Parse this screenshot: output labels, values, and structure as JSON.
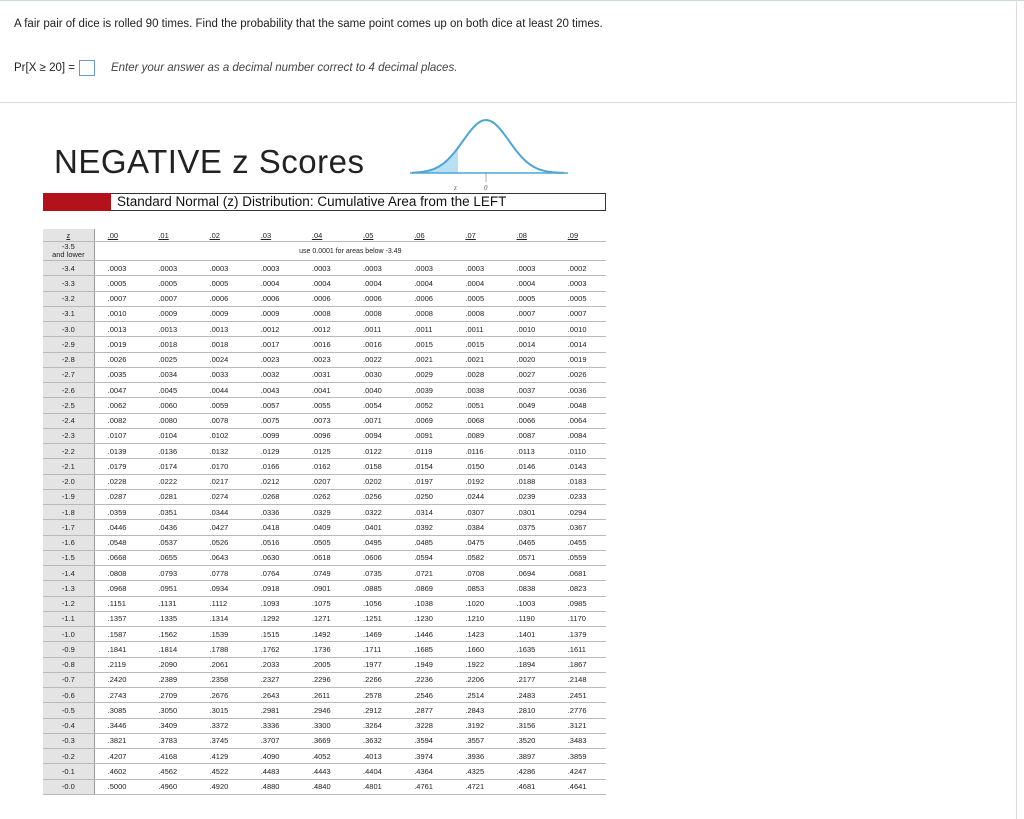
{
  "question": "A fair pair of dice is rolled 90 times. Find the probability that the same point comes up on both dice at least 20 times.",
  "answer": {
    "label": "Pr[X ≥ 20] =",
    "value": "",
    "hint": "Enter your answer as a decimal number correct to 4 decimal places."
  },
  "ztable": {
    "title": "NEGATIVE z Scores",
    "subtitle": "Standard Normal (z) Distribution:  Cumulative Area from the LEFT",
    "curve_labels": {
      "z": "z",
      "zero": "0"
    },
    "colors": {
      "accent": "#b3121a",
      "curve": "#4ba6d6",
      "shade": "#b9dff2"
    },
    "headers": [
      "z",
      ".00",
      ".01",
      ".02",
      ".03",
      ".04",
      ".05",
      ".06",
      ".07",
      ".08",
      ".09"
    ],
    "special_row": {
      "z": "-3.5\nand lower",
      "note": "use 0.0001 for areas below -3.49"
    },
    "rows": [
      [
        "-3.4",
        ".0003",
        ".0003",
        ".0003",
        ".0003",
        ".0003",
        ".0003",
        ".0003",
        ".0003",
        ".0003",
        ".0002"
      ],
      [
        "-3.3",
        ".0005",
        ".0005",
        ".0005",
        ".0004",
        ".0004",
        ".0004",
        ".0004",
        ".0004",
        ".0004",
        ".0003"
      ],
      [
        "-3.2",
        ".0007",
        ".0007",
        ".0006",
        ".0006",
        ".0006",
        ".0006",
        ".0006",
        ".0005",
        ".0005",
        ".0005"
      ],
      [
        "-3.1",
        ".0010",
        ".0009",
        ".0009",
        ".0009",
        ".0008",
        ".0008",
        ".0008",
        ".0008",
        ".0007",
        ".0007"
      ],
      [
        "-3.0",
        ".0013",
        ".0013",
        ".0013",
        ".0012",
        ".0012",
        ".0011",
        ".0011",
        ".0011",
        ".0010",
        ".0010"
      ],
      [
        "-2.9",
        ".0019",
        ".0018",
        ".0018",
        ".0017",
        ".0016",
        ".0016",
        ".0015",
        ".0015",
        ".0014",
        ".0014"
      ],
      [
        "-2.8",
        ".0026",
        ".0025",
        ".0024",
        ".0023",
        ".0023",
        ".0022",
        ".0021",
        ".0021",
        ".0020",
        ".0019"
      ],
      [
        "-2.7",
        ".0035",
        ".0034",
        ".0033",
        ".0032",
        ".0031",
        ".0030",
        ".0029",
        ".0028",
        ".0027",
        ".0026"
      ],
      [
        "-2.6",
        ".0047",
        ".0045",
        ".0044",
        ".0043",
        ".0041",
        ".0040",
        ".0039",
        ".0038",
        ".0037",
        ".0036"
      ],
      [
        "-2.5",
        ".0062",
        ".0060",
        ".0059",
        ".0057",
        ".0055",
        ".0054",
        ".0052",
        ".0051",
        ".0049",
        ".0048"
      ],
      [
        "-2.4",
        ".0082",
        ".0080",
        ".0078",
        ".0075",
        ".0073",
        ".0071",
        ".0069",
        ".0068",
        ".0066",
        ".0064"
      ],
      [
        "-2.3",
        ".0107",
        ".0104",
        ".0102",
        ".0099",
        ".0096",
        ".0094",
        ".0091",
        ".0089",
        ".0087",
        ".0084"
      ],
      [
        "-2.2",
        ".0139",
        ".0136",
        ".0132",
        ".0129",
        ".0125",
        ".0122",
        ".0119",
        ".0116",
        ".0113",
        ".0110"
      ],
      [
        "-2.1",
        ".0179",
        ".0174",
        ".0170",
        ".0166",
        ".0162",
        ".0158",
        ".0154",
        ".0150",
        ".0146",
        ".0143"
      ],
      [
        "-2.0",
        ".0228",
        ".0222",
        ".0217",
        ".0212",
        ".0207",
        ".0202",
        ".0197",
        ".0192",
        ".0188",
        ".0183"
      ],
      [
        "-1.9",
        ".0287",
        ".0281",
        ".0274",
        ".0268",
        ".0262",
        ".0256",
        ".0250",
        ".0244",
        ".0239",
        ".0233"
      ],
      [
        "-1.8",
        ".0359",
        ".0351",
        ".0344",
        ".0336",
        ".0329",
        ".0322",
        ".0314",
        ".0307",
        ".0301",
        ".0294"
      ],
      [
        "-1.7",
        ".0446",
        ".0436",
        ".0427",
        ".0418",
        ".0409",
        ".0401",
        ".0392",
        ".0384",
        ".0375",
        ".0367"
      ],
      [
        "-1.6",
        ".0548",
        ".0537",
        ".0526",
        ".0516",
        ".0505",
        ".0495",
        ".0485",
        ".0475",
        ".0465",
        ".0455"
      ],
      [
        "-1.5",
        ".0668",
        ".0655",
        ".0643",
        ".0630",
        ".0618",
        ".0606",
        ".0594",
        ".0582",
        ".0571",
        ".0559"
      ],
      [
        "-1.4",
        ".0808",
        ".0793",
        ".0778",
        ".0764",
        ".0749",
        ".0735",
        ".0721",
        ".0708",
        ".0694",
        ".0681"
      ],
      [
        "-1.3",
        ".0968",
        ".0951",
        ".0934",
        ".0918",
        ".0901",
        ".0885",
        ".0869",
        ".0853",
        ".0838",
        ".0823"
      ],
      [
        "-1.2",
        ".1151",
        ".1131",
        ".1112",
        ".1093",
        ".1075",
        ".1056",
        ".1038",
        ".1020",
        ".1003",
        ".0985"
      ],
      [
        "-1.1",
        ".1357",
        ".1335",
        ".1314",
        ".1292",
        ".1271",
        ".1251",
        ".1230",
        ".1210",
        ".1190",
        ".1170"
      ],
      [
        "-1.0",
        ".1587",
        ".1562",
        ".1539",
        ".1515",
        ".1492",
        ".1469",
        ".1446",
        ".1423",
        ".1401",
        ".1379"
      ],
      [
        "-0.9",
        ".1841",
        ".1814",
        ".1788",
        ".1762",
        ".1736",
        ".1711",
        ".1685",
        ".1660",
        ".1635",
        ".1611"
      ],
      [
        "-0.8",
        ".2119",
        ".2090",
        ".2061",
        ".2033",
        ".2005",
        ".1977",
        ".1949",
        ".1922",
        ".1894",
        ".1867"
      ],
      [
        "-0.7",
        ".2420",
        ".2389",
        ".2358",
        ".2327",
        ".2296",
        ".2266",
        ".2236",
        ".2206",
        ".2177",
        ".2148"
      ],
      [
        "-0.6",
        ".2743",
        ".2709",
        ".2676",
        ".2643",
        ".2611",
        ".2578",
        ".2546",
        ".2514",
        ".2483",
        ".2451"
      ],
      [
        "-0.5",
        ".3085",
        ".3050",
        ".3015",
        ".2981",
        ".2946",
        ".2912",
        ".2877",
        ".2843",
        ".2810",
        ".2776"
      ],
      [
        "-0.4",
        ".3446",
        ".3409",
        ".3372",
        ".3336",
        ".3300",
        ".3264",
        ".3228",
        ".3192",
        ".3156",
        ".3121"
      ],
      [
        "-0.3",
        ".3821",
        ".3783",
        ".3745",
        ".3707",
        ".3669",
        ".3632",
        ".3594",
        ".3557",
        ".3520",
        ".3483"
      ],
      [
        "-0.2",
        ".4207",
        ".4168",
        ".4129",
        ".4090",
        ".4052",
        ".4013",
        ".3974",
        ".3936",
        ".3897",
        ".3859"
      ],
      [
        "-0.1",
        ".4602",
        ".4562",
        ".4522",
        ".4483",
        ".4443",
        ".4404",
        ".4364",
        ".4325",
        ".4286",
        ".4247"
      ],
      [
        "-0.0",
        ".5000",
        ".4960",
        ".4920",
        ".4880",
        ".4840",
        ".4801",
        ".4761",
        ".4721",
        ".4681",
        ".4641"
      ]
    ]
  }
}
